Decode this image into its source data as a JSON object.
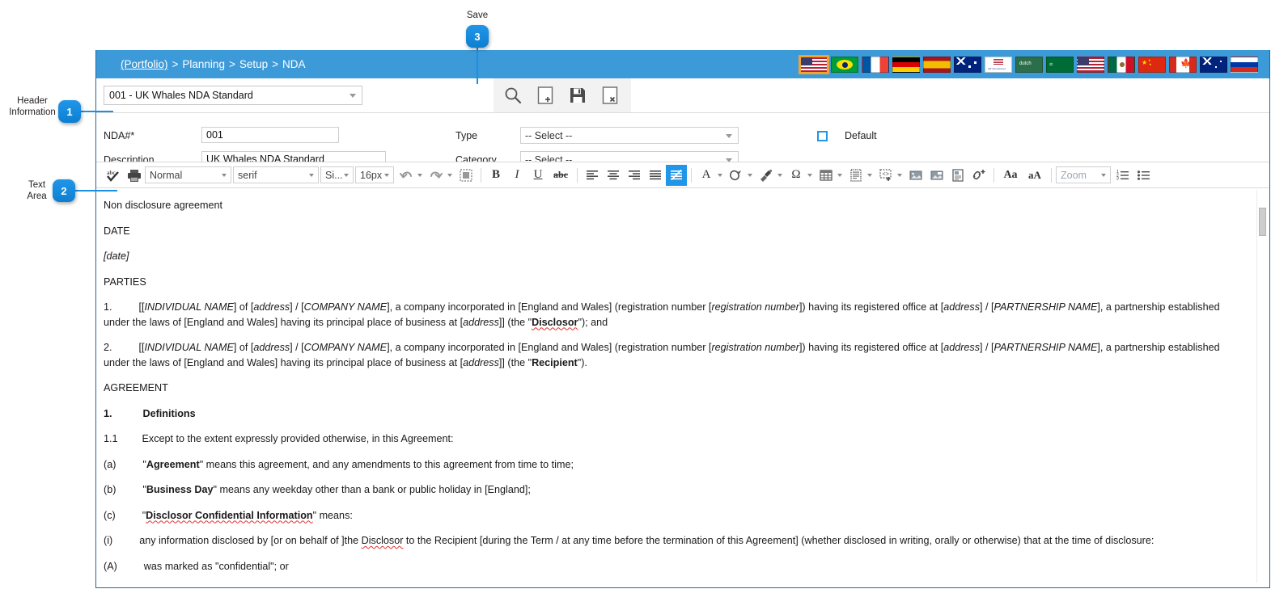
{
  "callouts": [
    {
      "id": "1",
      "label": "Header\nInformation"
    },
    {
      "id": "2",
      "label": "Text\nArea"
    },
    {
      "id": "3",
      "label": "Save"
    }
  ],
  "breadcrumb": {
    "items": [
      "(Portfolio)",
      "Planning",
      "Setup",
      "NDA"
    ],
    "separator": ">"
  },
  "flags": [
    {
      "name": "flag-usa-selected",
      "title": "English (US)"
    },
    {
      "name": "flag-brazil",
      "title": "Portuguese (Brazil)"
    },
    {
      "name": "flag-france",
      "title": "French"
    },
    {
      "name": "flag-germany",
      "title": "German"
    },
    {
      "name": "flag-spain",
      "title": "Spanish"
    },
    {
      "name": "flag-australia",
      "title": "English (Australia)"
    },
    {
      "name": "flag-international",
      "title": "International"
    },
    {
      "name": "flag-dutch",
      "title": "Dutch"
    },
    {
      "name": "flag-saudi-arabia",
      "title": "Arabic"
    },
    {
      "name": "flag-usa",
      "title": "English (US)"
    },
    {
      "name": "flag-mexico",
      "title": "Spanish (Mexico)"
    },
    {
      "name": "flag-china",
      "title": "Chinese"
    },
    {
      "name": "flag-canada",
      "title": "English (Canada)"
    },
    {
      "name": "flag-new-zealand",
      "title": "English (New Zealand)"
    },
    {
      "name": "flag-russia",
      "title": "Russian"
    }
  ],
  "record_bar": {
    "selected_record": "001 - UK Whales NDA Standard",
    "actions": [
      {
        "name": "search-icon",
        "label": "Search"
      },
      {
        "name": "new-record-icon",
        "label": "New"
      },
      {
        "name": "save-icon",
        "label": "Save"
      },
      {
        "name": "delete-record-icon",
        "label": "Delete"
      }
    ]
  },
  "header_fields": {
    "nda_number_label": "NDA#*",
    "nda_number_value": "001",
    "description_label": "Description",
    "description_value": "UK Whales NDA Standard",
    "type_label": "Type",
    "type_value": "-- Select --",
    "category_label": "Category",
    "category_value": "-- Select --",
    "default_label": "Default",
    "default_checked": false
  },
  "editor_toolbar": {
    "spellcheck": "abc-check-icon",
    "print": "printer-icon",
    "paragraph_format": "Normal",
    "font_family": "serif",
    "font_size_label": "Si...",
    "font_size": "16px",
    "undo": "undo-icon",
    "redo": "redo-icon",
    "select_all": "select-all-icon",
    "bold": "B",
    "italic": "I",
    "underline": "U",
    "strikethrough": "abc",
    "align_left": "align-left-icon",
    "align_center": "align-center-icon",
    "align_right": "align-right-icon",
    "align_justify": "align-justify-icon",
    "remove_format": "remove-format-icon",
    "text_color": "A",
    "background_color": "fill-color-icon",
    "paint_format": "paint-brush-icon",
    "special_char": "Ω",
    "table": "table-icon",
    "page_break": "page-layout-icon",
    "insert_block": "insert-code-icon",
    "insert_image": "image-icon",
    "insert_picture": "picture-icon",
    "insert_document": "document-image-icon",
    "insert_link": "link-add-icon",
    "increase_font": "Aa",
    "decrease_font": "aA",
    "zoom_label": "Zoom",
    "ordered_list": "numbered-list-icon",
    "unordered_list": "bullet-list-icon"
  },
  "document": {
    "title": "Non disclosure agreement",
    "date_heading": "DATE",
    "date_placeholder": "[date]",
    "parties_heading": "PARTIES",
    "party_1": {
      "number": "1.",
      "before": "[[",
      "individual_name": "INDIVIDUAL NAME",
      "t1": "] of [",
      "address_1": "address",
      "t2": "] / [",
      "company_name": "COMPANY NAME",
      "t3": "], a company incorporated in [England and Wales] (registration number [",
      "registration_number": "registration number",
      "t4": "]) having its registered office at [",
      "address_2": "address",
      "t5": "] / [",
      "partnership_name": "PARTNERSHIP NAME",
      "t6": "], a partnership established under the laws of [England and Wales] having its principal place of business at [",
      "address_3": "address",
      "t7": "]] (the \"",
      "role": "Disclosor",
      "t8": "\"); and"
    },
    "party_2": {
      "number": "2.",
      "before": "[[",
      "individual_name": "INDIVIDUAL NAME",
      "t1": "] of [",
      "address_1": "address",
      "t2": "] / [",
      "company_name": "COMPANY NAME",
      "t3": "], a company incorporated in [England and Wales] (registration number [",
      "registration_number": "registration number",
      "t4": "]) having its registered office at [",
      "address_2": "address",
      "t5": "] / [",
      "partnership_name": "PARTNERSHIP NAME",
      "t6": "], a partnership established under the laws of [England and Wales] having its principal place of business at [",
      "address_3": "address",
      "t7": "]] (the \"",
      "role": "Recipient",
      "t8": "\")."
    },
    "agreement_heading": "AGREEMENT",
    "clause_1_number": "1.",
    "clause_1_title": "Definitions",
    "clause_11_number": "1.1",
    "clause_11_text": "Except to the extent expressly provided otherwise, in this Agreement:",
    "def_a_number": "(a)",
    "def_a_term": "Agreement",
    "def_a_text": "\" means this agreement, and any amendments to this agreement from time to time;",
    "def_b_number": "(b)",
    "def_b_term": "Business Day",
    "def_b_text": "\" means any weekday other than a bank or public holiday in [England];",
    "def_c_number": "(c)",
    "def_c_term": "Disclosor Confidential Information",
    "def_c_text": "\" means:",
    "def_i_number": "(i)",
    "def_i_text_1": "any information disclosed by [or on behalf of ]the ",
    "def_i_disclosor": "Disclosor",
    "def_i_text_2": " to the Recipient [during the Term / at any time before the termination of this Agreement] (whether disclosed in writing, orally or otherwise) that at the time of disclosure:",
    "def_A_number": "(A)",
    "def_A_text": "was marked as \"confidential\"; or",
    "quote_open": "\""
  },
  "colors": {
    "header_blue": "#3d9ad9",
    "window_border": "#2a6496",
    "callout_blue": "#1a8fe3",
    "accent_active": "#2196e8",
    "toolbar_grey": "#f2f2f2"
  }
}
